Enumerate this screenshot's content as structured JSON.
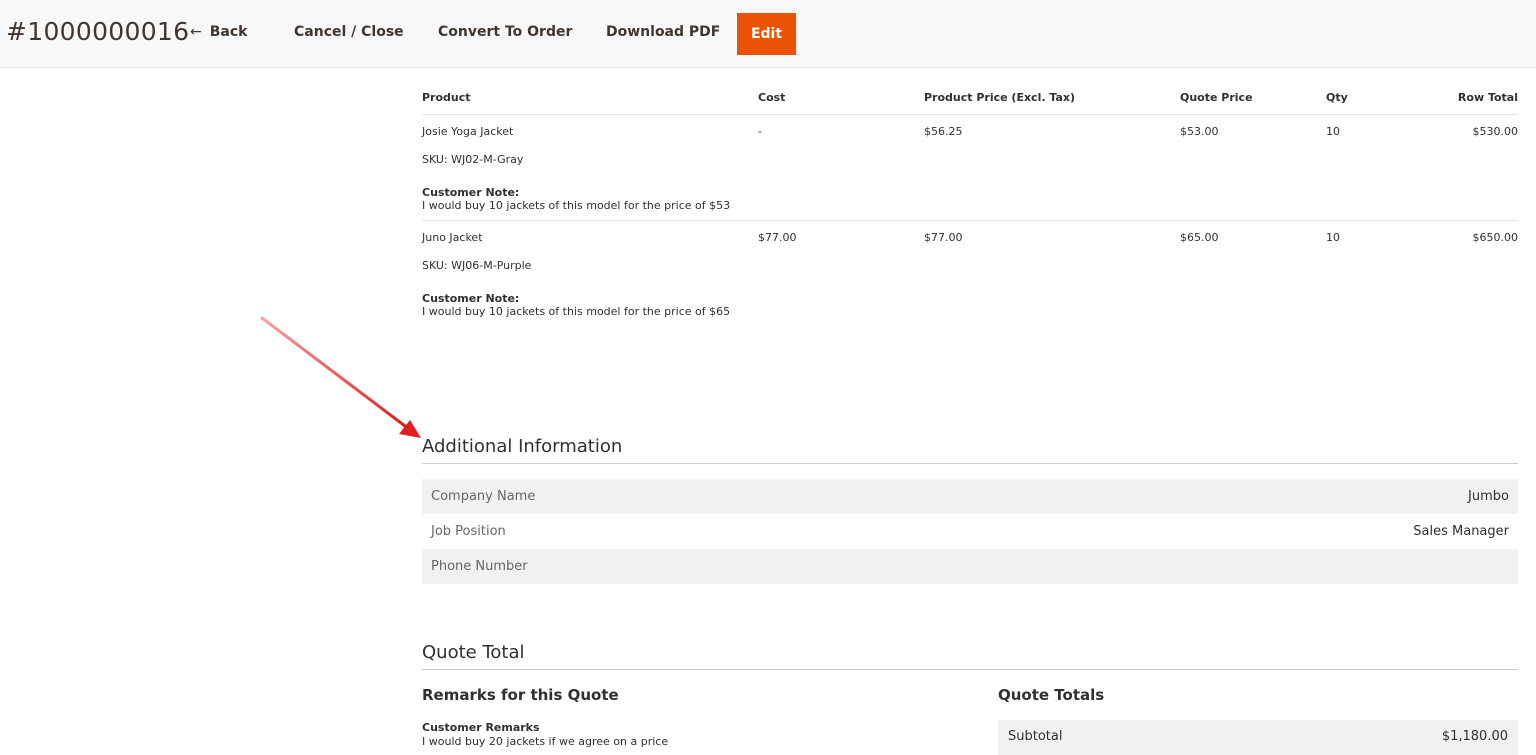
{
  "toolbar": {
    "quote_id": "#1000000016",
    "back_label": "Back",
    "back_arrow": "←",
    "cancel_label": "Cancel / Close",
    "convert_label": "Convert To Order",
    "pdf_label": "Download PDF",
    "edit_label": "Edit",
    "edit_color": "#eb5202"
  },
  "items": {
    "headers": [
      "Product",
      "Cost",
      "Product Price (Excl. Tax)",
      "Quote Price",
      "Qty",
      "Row Total"
    ],
    "rows": [
      {
        "name": "Josie Yoga Jacket",
        "sku": "SKU: WJ02-M-Gray",
        "cost": "-",
        "price": "$56.25",
        "quote_price": "$53.00",
        "qty": "10",
        "row_total": "$530.00",
        "note_label": "Customer Note:",
        "note": "I would buy 10 jackets of this model for the price of $53"
      },
      {
        "name": "Juno Jacket",
        "sku": "SKU: WJ06-M-Purple",
        "cost": "$77.00",
        "price": "$77.00",
        "quote_price": "$65.00",
        "qty": "10",
        "row_total": "$650.00",
        "note_label": "Customer Note:",
        "note": "I would buy 10 jackets of this model for the price of $65"
      }
    ]
  },
  "additional_info": {
    "title": "Additional Information",
    "rows": [
      {
        "label": "Company Name",
        "value": "Jumbo"
      },
      {
        "label": "Job Position",
        "value": "Sales Manager"
      },
      {
        "label": "Phone Number",
        "value": ""
      }
    ]
  },
  "quote_total": {
    "title": "Quote Total",
    "remarks_title": "Remarks for this Quote",
    "customer_remarks_label": "Customer Remarks",
    "customer_remarks": "I would buy 20 jackets if we agree on a price",
    "totals_title": "Quote Totals",
    "subtotal_label": "Subtotal",
    "subtotal_value": "$1,180.00"
  },
  "annotation": {
    "arrow_color": "#e01e1e"
  }
}
